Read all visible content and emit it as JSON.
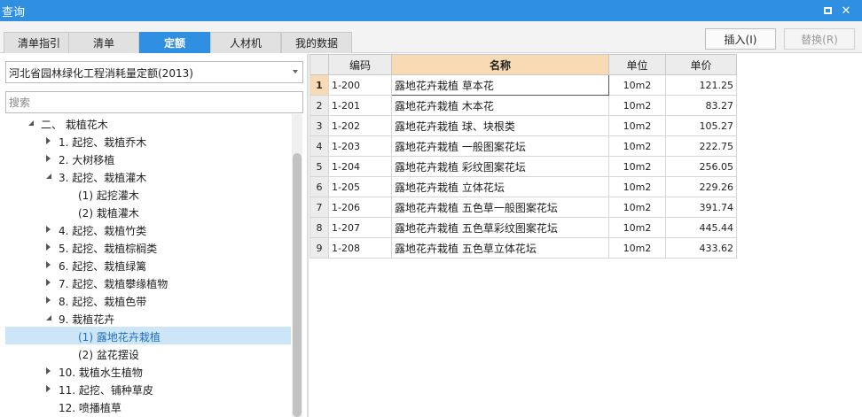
{
  "window": {
    "title": "查询"
  },
  "tabs": [
    {
      "label": "清单指引",
      "active": false
    },
    {
      "label": "清单",
      "active": false
    },
    {
      "label": "定额",
      "active": true
    },
    {
      "label": "人材机",
      "active": false
    },
    {
      "label": "我的数据",
      "active": false
    }
  ],
  "buttons": {
    "insert": "插入(I)",
    "replace": "替换(R)"
  },
  "library": {
    "selected": "河北省园林绿化工程消耗量定额(2013)"
  },
  "search": {
    "placeholder": "搜索"
  },
  "tree": [
    {
      "label": "二、 栽植花木",
      "level": 0,
      "toggle": "expanded",
      "selected": false
    },
    {
      "label": "1. 起挖、栽植乔木",
      "level": 1,
      "toggle": "collapsed",
      "selected": false
    },
    {
      "label": "2. 大树移植",
      "level": 1,
      "toggle": "collapsed",
      "selected": false
    },
    {
      "label": "3. 起挖、栽植灌木",
      "level": 1,
      "toggle": "expanded",
      "selected": false
    },
    {
      "label": "(1) 起挖灌木",
      "level": 2,
      "toggle": "none",
      "selected": false
    },
    {
      "label": "(2) 栽植灌木",
      "level": 2,
      "toggle": "none",
      "selected": false
    },
    {
      "label": "4. 起挖、栽植竹类",
      "level": 1,
      "toggle": "collapsed",
      "selected": false
    },
    {
      "label": "5. 起挖、栽植棕榈类",
      "level": 1,
      "toggle": "collapsed",
      "selected": false
    },
    {
      "label": "6. 起挖、栽植绿篱",
      "level": 1,
      "toggle": "collapsed",
      "selected": false
    },
    {
      "label": "7. 起挖、栽植攀缘植物",
      "level": 1,
      "toggle": "collapsed",
      "selected": false
    },
    {
      "label": "8. 起挖、栽植色带",
      "level": 1,
      "toggle": "collapsed",
      "selected": false
    },
    {
      "label": "9. 栽植花卉",
      "level": 1,
      "toggle": "expanded",
      "selected": false
    },
    {
      "label": "(1) 露地花卉栽植",
      "level": 2,
      "toggle": "none",
      "selected": true
    },
    {
      "label": "(2) 盆花摆设",
      "level": 2,
      "toggle": "none",
      "selected": false
    },
    {
      "label": "10. 栽植水生植物",
      "level": 1,
      "toggle": "collapsed",
      "selected": false
    },
    {
      "label": "11. 起挖、铺种草皮",
      "level": 1,
      "toggle": "collapsed",
      "selected": false
    },
    {
      "label": "12. 喷播植草",
      "level": 1,
      "toggle": "none",
      "selected": false
    }
  ],
  "grid": {
    "columns": {
      "code": "编码",
      "name": "名称",
      "unit": "单位",
      "price": "单价"
    },
    "rows": [
      {
        "n": "1",
        "code": "1-200",
        "name": "露地花卉栽植 草本花",
        "unit": "10m2",
        "price": "121.25",
        "current": true
      },
      {
        "n": "2",
        "code": "1-201",
        "name": "露地花卉栽植 木本花",
        "unit": "10m2",
        "price": "83.27",
        "current": false
      },
      {
        "n": "3",
        "code": "1-202",
        "name": "露地花卉栽植 球、块根类",
        "unit": "10m2",
        "price": "105.27",
        "current": false
      },
      {
        "n": "4",
        "code": "1-203",
        "name": "露地花卉栽植 一般图案花坛",
        "unit": "10m2",
        "price": "222.75",
        "current": false
      },
      {
        "n": "5",
        "code": "1-204",
        "name": "露地花卉栽植 彩纹图案花坛",
        "unit": "10m2",
        "price": "256.05",
        "current": false
      },
      {
        "n": "6",
        "code": "1-205",
        "name": "露地花卉栽植 立体花坛",
        "unit": "10m2",
        "price": "229.26",
        "current": false
      },
      {
        "n": "7",
        "code": "1-206",
        "name": "露地花卉栽植 五色草一般图案花坛",
        "unit": "10m2",
        "price": "391.74",
        "current": false
      },
      {
        "n": "8",
        "code": "1-207",
        "name": "露地花卉栽植 五色草彩纹图案花坛",
        "unit": "10m2",
        "price": "445.44",
        "current": false
      },
      {
        "n": "9",
        "code": "1-208",
        "name": "露地花卉栽植 五色草立体花坛",
        "unit": "10m2",
        "price": "433.62",
        "current": false
      }
    ]
  }
}
